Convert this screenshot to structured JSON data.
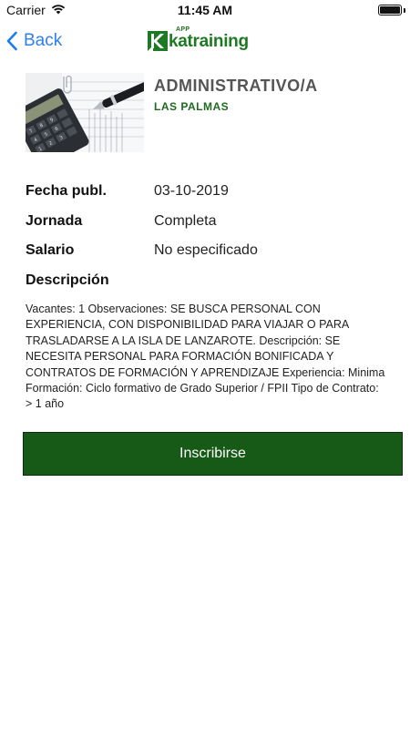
{
  "status_bar": {
    "carrier": "Carrier",
    "time": "11:45 AM",
    "battery_level": 1.0
  },
  "nav": {
    "back_label": "Back",
    "logo": {
      "superscript": "APP",
      "wordmark": "katraining",
      "brand_color": "#1e7a22"
    }
  },
  "job": {
    "title": "ADMINISTRATIVO/A",
    "location": "LAS PALMAS",
    "image_icon": "calculator-photo"
  },
  "details": {
    "fecha_label": "Fecha publ.",
    "fecha_value": "03-10-2019",
    "jornada_label": "Jornada",
    "jornada_value": "Completa",
    "salario_label": "Salario",
    "salario_value": "No especificado"
  },
  "description": {
    "label": "Descripción",
    "text": "Vacantes: 1 Observaciones: SE BUSCA PERSONAL CON EXPERIENCIA, CON DISPONIBILIDAD PARA VIAJAR O PARA TRASLADARSE A LA ISLA DE LANZAROTE. Descripción: SE NECESITA PERSONAL PARA FORMACIÓN BONIFICADA Y CONTRATOS DE FORMACIÓN Y APRENDIZAJE Experiencia: Minima Formación: Ciclo formativo de Grado Superior / FPII Tipo de Contrato: > 1 año"
  },
  "actions": {
    "inscribirse_label": "Inscribirse",
    "button_color": "#175a17"
  }
}
